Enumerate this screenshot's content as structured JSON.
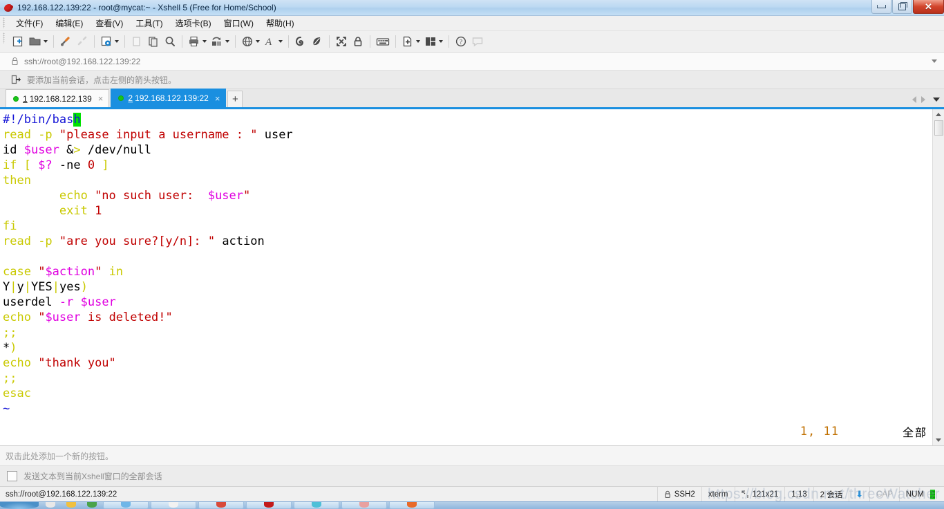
{
  "window": {
    "title": "192.168.122.139:22 - root@mycat:~ - Xshell 5 (Free for Home/School)",
    "app_icon": "xshell-icon",
    "minimize_label": "—",
    "restore_label": "❐",
    "close_label": "✕"
  },
  "menu": {
    "items": [
      {
        "label": "文件(F)",
        "name": "menu-file"
      },
      {
        "label": "编辑(E)",
        "name": "menu-edit"
      },
      {
        "label": "查看(V)",
        "name": "menu-view"
      },
      {
        "label": "工具(T)",
        "name": "menu-tools"
      },
      {
        "label": "选项卡(B)",
        "name": "menu-tabs"
      },
      {
        "label": "窗口(W)",
        "name": "menu-window"
      },
      {
        "label": "帮助(H)",
        "name": "menu-help"
      }
    ]
  },
  "toolbar": {
    "items": [
      {
        "icon": "new-session-icon"
      },
      {
        "icon": "open-folder-icon",
        "caret": true
      },
      {
        "icon": "connect-icon"
      },
      {
        "icon": "disconnect-icon"
      },
      {
        "icon": "session-properties-icon",
        "caret": true
      },
      {
        "icon": "copy-icon"
      },
      {
        "icon": "paste-icon"
      },
      {
        "icon": "find-icon"
      },
      {
        "icon": "print-icon",
        "caret": true
      },
      {
        "icon": "transfer-icon",
        "caret": true
      },
      {
        "icon": "globe-icon",
        "caret": true
      },
      {
        "icon": "font-icon",
        "caret": true
      },
      {
        "icon": "spiral-icon"
      },
      {
        "icon": "leaf-icon"
      },
      {
        "icon": "fullscreen-icon"
      },
      {
        "icon": "lock-icon"
      },
      {
        "icon": "keyboard-icon"
      },
      {
        "icon": "new-file-icon",
        "caret": true
      },
      {
        "icon": "layout-icon",
        "caret": true
      },
      {
        "icon": "help-icon"
      },
      {
        "icon": "chat-icon"
      }
    ]
  },
  "address": {
    "icon": "lock-icon",
    "value": "ssh://root@192.168.122.139:22",
    "dropdown_icon": "chevron-down-icon"
  },
  "notice": {
    "icon": "add-session-icon",
    "text": "要添加当前会话，点击左侧的箭头按钮。"
  },
  "tabs": {
    "items": [
      {
        "number": "1",
        "label": "192.168.122.139",
        "active": false,
        "status": "connected"
      },
      {
        "number": "2",
        "label": "192.168.122.139:22",
        "active": true,
        "status": "connected"
      }
    ],
    "new_tab_label": "+",
    "close_label": "×",
    "nav_prev": "prev-tab-arrow",
    "nav_next": "next-tab-arrow",
    "nav_list": "tab-list-dropdown"
  },
  "terminal": {
    "lines": [
      [
        {
          "t": "#!/bin/bas",
          "c": "comment"
        },
        {
          "t": "h",
          "c": "cursor"
        }
      ],
      [
        {
          "t": "read ",
          "c": "kw"
        },
        {
          "t": "-p ",
          "c": "kw"
        },
        {
          "t": "\"please input a username : \"",
          "c": "str"
        },
        {
          "t": " user",
          "c": "plain"
        }
      ],
      [
        {
          "t": "id ",
          "c": "plain"
        },
        {
          "t": "$user",
          "c": "var"
        },
        {
          "t": " &",
          "c": "plain"
        },
        {
          "t": ">",
          "c": "kw"
        },
        {
          "t": " /dev/null",
          "c": "plain"
        }
      ],
      [
        {
          "t": "if ",
          "c": "kw"
        },
        {
          "t": "[ ",
          "c": "kw"
        },
        {
          "t": "$?",
          "c": "var"
        },
        {
          "t": " -ne ",
          "c": "plain"
        },
        {
          "t": "0",
          "c": "num"
        },
        {
          "t": " ]",
          "c": "kw"
        }
      ],
      [
        {
          "t": "then",
          "c": "kw"
        }
      ],
      [
        {
          "t": "        echo ",
          "c": "kw"
        },
        {
          "t": "\"no such user:  ",
          "c": "str"
        },
        {
          "t": "$user",
          "c": "var"
        },
        {
          "t": "\"",
          "c": "str"
        }
      ],
      [
        {
          "t": "        exit ",
          "c": "kw"
        },
        {
          "t": "1",
          "c": "num"
        }
      ],
      [
        {
          "t": "fi",
          "c": "kw"
        }
      ],
      [
        {
          "t": "read ",
          "c": "kw"
        },
        {
          "t": "-p ",
          "c": "kw"
        },
        {
          "t": "\"are you sure?[y/n]: \"",
          "c": "str"
        },
        {
          "t": " action",
          "c": "plain"
        }
      ],
      [
        {
          "t": "",
          "c": "plain"
        }
      ],
      [
        {
          "t": "case ",
          "c": "kw"
        },
        {
          "t": "\"",
          "c": "str"
        },
        {
          "t": "$action",
          "c": "var"
        },
        {
          "t": "\"",
          "c": "str"
        },
        {
          "t": " in",
          "c": "kw"
        }
      ],
      [
        {
          "t": "Y",
          "c": "plain"
        },
        {
          "t": "|",
          "c": "kw"
        },
        {
          "t": "y",
          "c": "plain"
        },
        {
          "t": "|",
          "c": "kw"
        },
        {
          "t": "YES",
          "c": "plain"
        },
        {
          "t": "|",
          "c": "kw"
        },
        {
          "t": "yes",
          "c": "plain"
        },
        {
          "t": ")",
          "c": "kw"
        }
      ],
      [
        {
          "t": "userdel ",
          "c": "plain"
        },
        {
          "t": "-r ",
          "c": "var"
        },
        {
          "t": "$user",
          "c": "var"
        }
      ],
      [
        {
          "t": "echo ",
          "c": "kw"
        },
        {
          "t": "\"",
          "c": "str"
        },
        {
          "t": "$user",
          "c": "var"
        },
        {
          "t": " is deleted!\"",
          "c": "str"
        }
      ],
      [
        {
          "t": ";;",
          "c": "kw"
        }
      ],
      [
        {
          "t": "*",
          "c": "plain"
        },
        {
          "t": ")",
          "c": "kw"
        }
      ],
      [
        {
          "t": "echo ",
          "c": "kw"
        },
        {
          "t": "\"thank you\"",
          "c": "str"
        }
      ],
      [
        {
          "t": ";;",
          "c": "kw"
        }
      ],
      [
        {
          "t": "esac",
          "c": "kw"
        }
      ],
      [
        {
          "t": "~",
          "c": "tilde"
        }
      ]
    ],
    "vim_position": "1, 11",
    "vim_scroll": "全部"
  },
  "quickbar": {
    "hint": "双击此处添加一个新的按钮。"
  },
  "sendbar": {
    "checkbox_checked": false,
    "label": "发送文本到当前Xshell窗口的全部会话"
  },
  "statusbar": {
    "connection": "ssh://root@192.168.122.139:22",
    "security_icon": "lock-icon",
    "protocol": "SSH2",
    "terminal_type": "xterm",
    "size_icon": "resize-icon",
    "size": "121x21",
    "cursor": "1,13",
    "sessions": "2 会话",
    "download_icon": "download-arrow-icon",
    "caps": "CAP",
    "num": "NUM",
    "watermark": "https://blog.csdn.net/threeWatcher"
  },
  "colors": {
    "accent": "#1a8fe0",
    "title_gradient_top": "#cfe3f5",
    "comment": "#1414d6",
    "keyword": "#c9c900",
    "string": "#c00000",
    "variable": "#e000e0",
    "cursor_bg": "#00e000",
    "tab_active_bg": "#1a8fe0",
    "status_green": "#19c419"
  }
}
